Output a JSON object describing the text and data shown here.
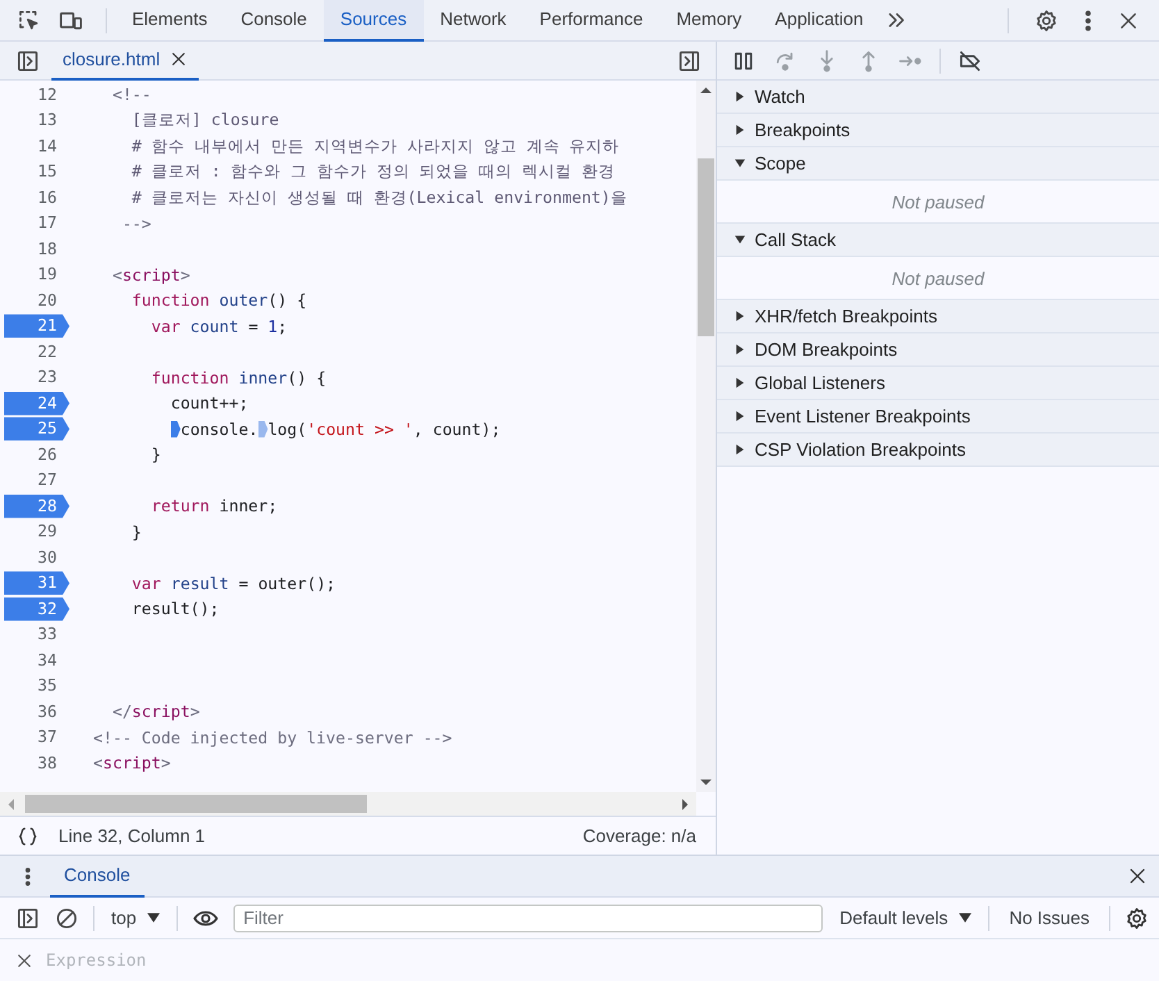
{
  "main_tabs": [
    {
      "label": "Elements",
      "selected": false
    },
    {
      "label": "Console",
      "selected": false
    },
    {
      "label": "Sources",
      "selected": true
    },
    {
      "label": "Network",
      "selected": false
    },
    {
      "label": "Performance",
      "selected": false
    },
    {
      "label": "Memory",
      "selected": false
    },
    {
      "label": "Application",
      "selected": false
    }
  ],
  "editor": {
    "file_tabs": [
      {
        "label": "closure.html",
        "selected": true
      }
    ],
    "lines": [
      {
        "number": "12",
        "breakpoint": false,
        "tokens": [
          {
            "kind": "punct",
            "text": "  <!--"
          }
        ]
      },
      {
        "number": "13",
        "breakpoint": false,
        "tokens": [
          {
            "kind": "comment",
            "text": "    [클로저] closure"
          }
        ]
      },
      {
        "number": "14",
        "breakpoint": false,
        "tokens": [
          {
            "kind": "comment",
            "text": "    # 함수 내부에서 만든 지역변수가 사라지지 않고 계속 유지하"
          }
        ]
      },
      {
        "number": "15",
        "breakpoint": false,
        "tokens": [
          {
            "kind": "comment",
            "text": "    # 클로저 : 함수와 그 함수가 정의 되었을 때의 렉시컬 환경"
          }
        ]
      },
      {
        "number": "16",
        "breakpoint": false,
        "tokens": [
          {
            "kind": "comment",
            "text": "    # 클로저는 자신이 생성될 때 환경(Lexical environment)을"
          }
        ]
      },
      {
        "number": "17",
        "breakpoint": false,
        "tokens": [
          {
            "kind": "punct",
            "text": "   -->"
          }
        ]
      },
      {
        "number": "18",
        "breakpoint": false
      },
      {
        "number": "19",
        "breakpoint": false,
        "tokens": [
          {
            "kind": "punct",
            "text": "  <"
          },
          {
            "kind": "tag",
            "text": "script"
          },
          {
            "kind": "punct",
            "text": ">"
          }
        ]
      },
      {
        "number": "20",
        "breakpoint": false,
        "tokens": [
          {
            "kind": "keyword",
            "text": "    function"
          },
          {
            "kind": "def",
            "text": " outer"
          },
          {
            "kind": "plain",
            "text": "() {"
          }
        ]
      },
      {
        "number": "21",
        "breakpoint": true,
        "tokens": [
          {
            "kind": "keyword",
            "text": "      var"
          },
          {
            "kind": "def",
            "text": " count"
          },
          {
            "kind": "plain",
            "text": " = "
          },
          {
            "kind": "number",
            "text": "1"
          },
          {
            "kind": "plain",
            "text": ";"
          }
        ]
      },
      {
        "number": "22",
        "breakpoint": false
      },
      {
        "number": "23",
        "breakpoint": false,
        "tokens": [
          {
            "kind": "keyword",
            "text": "      function"
          },
          {
            "kind": "def",
            "text": " inner"
          },
          {
            "kind": "plain",
            "text": "() {"
          }
        ]
      },
      {
        "number": "24",
        "breakpoint": true,
        "tokens": [
          {
            "kind": "plain",
            "text": "        count++;"
          }
        ]
      },
      {
        "number": "25",
        "breakpoint": true,
        "tokens": [
          {
            "kind": "plain",
            "text": "        console.",
            "marker_active": true
          },
          {
            "kind": "plain",
            "text": "log(",
            "marker_active": false
          },
          {
            "kind": "string",
            "text": "'count >> '"
          },
          {
            "kind": "plain",
            "text": ", count);"
          }
        ]
      },
      {
        "number": "26",
        "breakpoint": false,
        "tokens": [
          {
            "kind": "plain",
            "text": "      }"
          }
        ]
      },
      {
        "number": "27",
        "breakpoint": false
      },
      {
        "number": "28",
        "breakpoint": true,
        "tokens": [
          {
            "kind": "keyword",
            "text": "      return"
          },
          {
            "kind": "plain",
            "text": " inner;"
          }
        ]
      },
      {
        "number": "29",
        "breakpoint": false,
        "tokens": [
          {
            "kind": "plain",
            "text": "    }"
          }
        ]
      },
      {
        "number": "30",
        "breakpoint": false
      },
      {
        "number": "31",
        "breakpoint": true,
        "tokens": [
          {
            "kind": "keyword",
            "text": "    var"
          },
          {
            "kind": "def",
            "text": " result"
          },
          {
            "kind": "plain",
            "text": " = outer();"
          }
        ]
      },
      {
        "number": "32",
        "breakpoint": true,
        "tokens": [
          {
            "kind": "plain",
            "text": "    result();"
          }
        ]
      },
      {
        "number": "33",
        "breakpoint": false
      },
      {
        "number": "34",
        "breakpoint": false
      },
      {
        "number": "35",
        "breakpoint": false
      },
      {
        "number": "36",
        "breakpoint": false,
        "tokens": [
          {
            "kind": "punct",
            "text": "  </"
          },
          {
            "kind": "tag",
            "text": "script"
          },
          {
            "kind": "punct",
            "text": ">"
          }
        ]
      },
      {
        "number": "37",
        "breakpoint": false,
        "tokens": [
          {
            "kind": "punct",
            "text": "<!-- Code injected by live-server -->"
          }
        ]
      },
      {
        "number": "38",
        "breakpoint": false,
        "tokens": [
          {
            "kind": "punct",
            "text": "<"
          },
          {
            "kind": "tag",
            "text": "script"
          },
          {
            "kind": "punct",
            "text": ">"
          }
        ]
      }
    ]
  },
  "status_bar": {
    "position": "Line 32, Column 1",
    "coverage": "Coverage: n/a"
  },
  "debugger": {
    "controls": [
      {
        "kind": "pause",
        "disabled": false
      },
      {
        "kind": "step-over",
        "disabled": true
      },
      {
        "kind": "step-into",
        "disabled": true
      },
      {
        "kind": "step-out",
        "disabled": true
      },
      {
        "kind": "step",
        "disabled": true
      },
      {
        "kind": "deactivate",
        "disabled": false
      }
    ],
    "sections": [
      {
        "label": "Watch",
        "expanded": false
      },
      {
        "label": "Breakpoints",
        "expanded": false
      },
      {
        "label": "Scope",
        "expanded": true,
        "message": "Not paused"
      },
      {
        "label": "Call Stack",
        "expanded": true,
        "message": "Not paused"
      },
      {
        "label": "XHR/fetch Breakpoints",
        "expanded": false
      },
      {
        "label": "DOM Breakpoints",
        "expanded": false
      },
      {
        "label": "Global Listeners",
        "expanded": false
      },
      {
        "label": "Event Listener Breakpoints",
        "expanded": false
      },
      {
        "label": "CSP Violation Breakpoints",
        "expanded": false
      }
    ]
  },
  "drawer": {
    "tabs": [
      {
        "label": "Console",
        "selected": true
      }
    ],
    "context": "top",
    "filter": {
      "placeholder": "Filter"
    },
    "levels": "Default levels",
    "issues": "No Issues",
    "expression": {
      "placeholder": "Expression"
    }
  }
}
